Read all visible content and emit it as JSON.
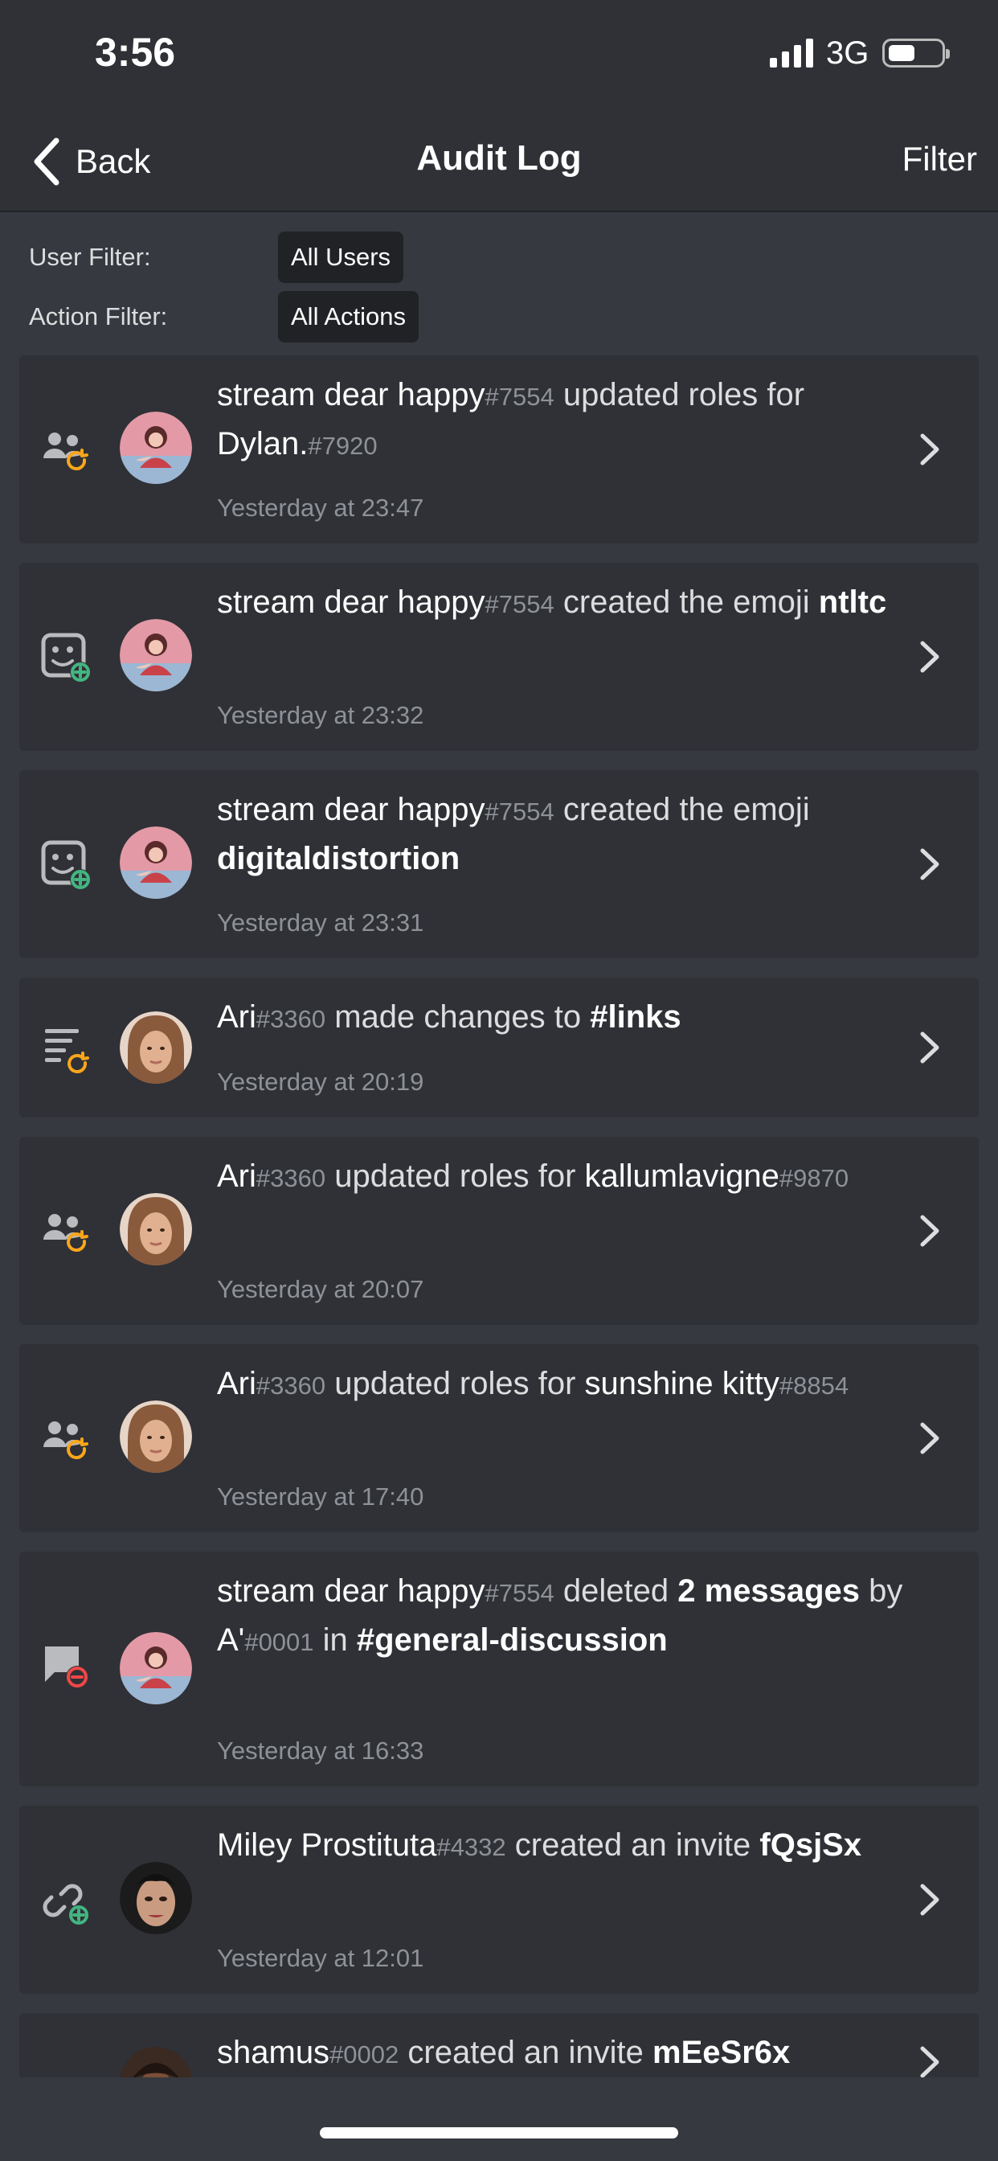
{
  "status_bar": {
    "time": "3:56",
    "network": "3G"
  },
  "nav": {
    "back_label": "Back",
    "title": "Audit Log",
    "filter_label": "Filter"
  },
  "filters": {
    "user_label": "User Filter:",
    "user_value": "All Users",
    "action_label": "Action Filter:",
    "action_value": "All Actions"
  },
  "entries": [
    {
      "icon": "roles-update-icon",
      "avatar": "avatar-stream-dear-happy",
      "user": "stream dear happy",
      "disc": "#7554",
      "parts": [
        " updated roles for ",
        "Dylan.",
        "#7920"
      ],
      "time": "Yesterday at 23:47"
    },
    {
      "icon": "emoji-create-icon",
      "avatar": "avatar-stream-dear-happy",
      "user": "stream dear happy",
      "disc": "#7554",
      "parts": [
        " created the emoji ",
        "ntltc"
      ],
      "time": "Yesterday at 23:32"
    },
    {
      "icon": "emoji-create-icon",
      "avatar": "avatar-stream-dear-happy",
      "user": "stream dear happy",
      "disc": "#7554",
      "parts": [
        " created the emoji ",
        "digitaldistortion"
      ],
      "time": "Yesterday at 23:31"
    },
    {
      "icon": "channel-update-icon",
      "avatar": "avatar-ari",
      "user": "Ari",
      "disc": "#3360",
      "parts": [
        " made changes to ",
        "#links"
      ],
      "time": "Yesterday at 20:19"
    },
    {
      "icon": "roles-update-icon",
      "avatar": "avatar-ari",
      "user": "Ari",
      "disc": "#3360",
      "parts": [
        " updated roles for ",
        "kallumlavigne",
        "#9870"
      ],
      "time": "Yesterday at 20:07"
    },
    {
      "icon": "roles-update-icon",
      "avatar": "avatar-ari",
      "user": "Ari",
      "disc": "#3360",
      "parts": [
        " updated roles for ",
        "sunshine kitty",
        "#8854"
      ],
      "time": "Yesterday at 17:40"
    },
    {
      "icon": "message-delete-icon",
      "avatar": "avatar-stream-dear-happy",
      "user": "stream dear happy",
      "disc": "#7554",
      "parts": [
        " deleted ",
        "2 messages",
        " by ",
        "A'",
        "#0001",
        " in ",
        "#general-discussion"
      ],
      "time": "Yesterday at 16:33"
    },
    {
      "icon": "invite-create-icon",
      "avatar": "avatar-miley",
      "user": "Miley Prostituta",
      "disc": "#4332",
      "parts": [
        " created an invite ",
        "fQsjSx"
      ],
      "time": "Yesterday at 12:01"
    },
    {
      "icon": "invite-create-icon",
      "avatar": "avatar-shamus",
      "user": "shamus",
      "disc": "#0002",
      "parts": [
        " created an invite ",
        "mEeSr6x"
      ],
      "time": ""
    }
  ],
  "colors": {
    "background": "#36393f",
    "card": "#2f3136",
    "chip": "#202225",
    "muted": "#8e9297",
    "update_accent": "#faa61a",
    "create_accent": "#43b581",
    "delete_accent": "#f04747"
  }
}
